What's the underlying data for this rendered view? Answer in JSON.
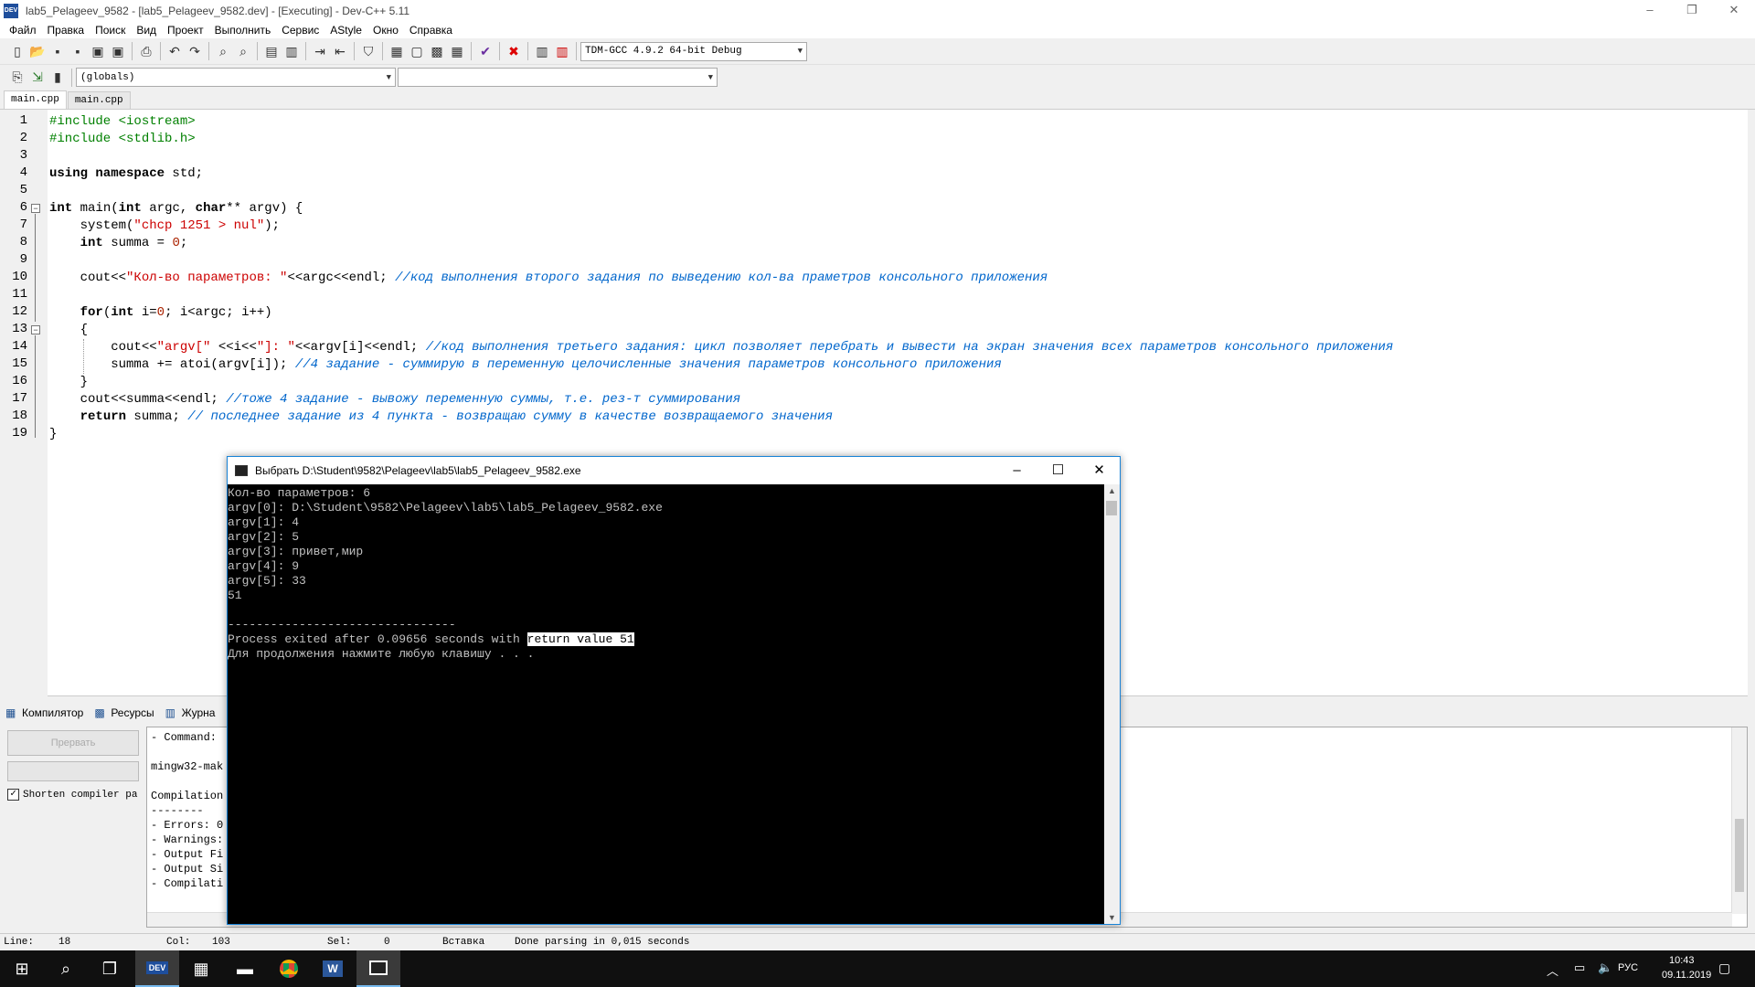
{
  "window": {
    "title": "lab5_Pelageev_9582 - [lab5_Pelageev_9582.dev] - [Executing] - Dev-C++ 5.11",
    "app_icon_label": "DEV",
    "minimize": "–",
    "restore": "❐",
    "close": "✕"
  },
  "menu": [
    "Файл",
    "Правка",
    "Поиск",
    "Вид",
    "Проект",
    "Выполнить",
    "Сервис",
    "AStyle",
    "Окно",
    "Справка"
  ],
  "toolbar": {
    "compiler_select": "TDM-GCC 4.9.2 64-bit Debug",
    "scope_select": "(globals)",
    "symbol_select": ""
  },
  "tabs": [
    "main.cpp",
    "main.cpp"
  ],
  "editor": {
    "line_numbers": [
      "1",
      "2",
      "3",
      "4",
      "5",
      "6",
      "7",
      "8",
      "9",
      "10",
      "11",
      "12",
      "13",
      "14",
      "15",
      "16",
      "17",
      "18",
      "19"
    ]
  },
  "code": {
    "l1": "#include <iostream>",
    "l2": "#include <stdlib.h>",
    "l4a": "using namespace",
    "l4b": " std;",
    "l6a": "int",
    "l6b": " main(",
    "l6c": "int",
    "l6d": " argc, ",
    "l6e": "char",
    "l6f": "** argv) {",
    "l7a": "    system(",
    "l7b": "\"chcp 1251 > nul\"",
    "l7c": ");",
    "l8a": "    ",
    "l8b": "int",
    "l8c": " summa = ",
    "l8d": "0",
    "l8e": ";",
    "l10a": "    cout<<",
    "l10b": "\"Кол-во параметров: \"",
    "l10c": "<<argc<<endl; ",
    "l10d": "//код выполнения второго задания по выведению кол-ва праметров консольного приложения",
    "l12a": "    ",
    "l12b": "for",
    "l12c": "(",
    "l12d": "int",
    "l12e": " i=",
    "l12f": "0",
    "l12g": "; i<argc; i++)",
    "l13": "    {",
    "l14a": "        cout<<",
    "l14b": "\"argv[\"",
    "l14c": " <<i<<",
    "l14d": "\"]: \"",
    "l14e": "<<argv[i]<<endl; ",
    "l14f": "//код выполнения третьего задания: цикл позволяет перебрать и вывести на экран значения всех параметров консольного приложения",
    "l15a": "        summa += atoi(argv[i]); ",
    "l15b": "//4 задание - суммирую в переменную целочисленные значения параметров консольного приложения",
    "l16": "    }",
    "l17a": "    cout<<summa<<endl; ",
    "l17b": "//тоже 4 задание - вывожу переменную суммы, т.е. рез-т суммирования",
    "l18a": "    ",
    "l18b": "return",
    "l18c": " summa; ",
    "l18d": "// последнее задание из 4 пункта - возвращаю сумму в качестве возвращаемого значения",
    "l19": "}"
  },
  "bottom_panel": {
    "tabs": [
      "Компилятор",
      "Ресурсы",
      "Журна"
    ],
    "abort_button": "Прервать",
    "shorten_label": "Shorten compiler pa",
    "shorten_checked": true,
    "log_lines": [
      "- Command: ",
      "",
      "mingw32-mak",
      "",
      "Compilation",
      "--------",
      "- Errors: 0",
      "- Warnings:",
      "- Output Fi",
      "- Output Si",
      "- Compilati"
    ]
  },
  "status": {
    "line_label": "Line:",
    "line_value": "18",
    "col_label": "Col:",
    "col_value": "103",
    "sel_label": "Sel:",
    "sel_value": "0",
    "mode": "Вставка",
    "message": "Done parsing in 0,015 seconds"
  },
  "console": {
    "title": "Выбрать D:\\Student\\9582\\Pelageev\\lab5\\lab5_Pelageev_9582.exe",
    "lines": [
      "Кол-во параметров: 6",
      "argv[0]: D:\\Student\\9582\\Pelageev\\lab5\\lab5_Pelageev_9582.exe",
      "argv[1]: 4",
      "argv[2]: 5",
      "argv[3]: привет,мир",
      "argv[4]: 9",
      "argv[5]: 33",
      "51",
      "",
      "--------------------------------"
    ],
    "exit_prefix": "Process exited after 0.09656 seconds with ",
    "exit_highlight": "return value 51",
    "press_key": "Для продолжения нажмите любую клавишу . . ."
  },
  "taskbar": {
    "lang": "РУС",
    "time": "10:43",
    "date": "09.11.2019"
  }
}
